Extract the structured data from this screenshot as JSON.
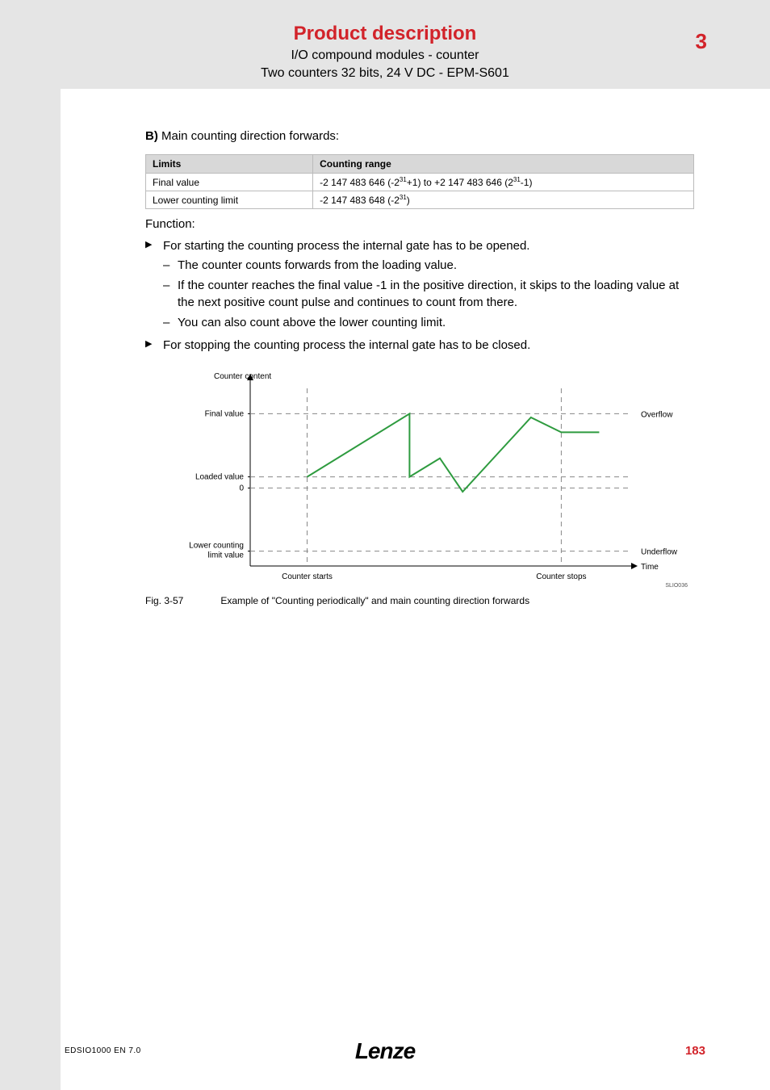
{
  "header": {
    "title": "Product description",
    "sub1": "I/O compound modules - counter",
    "sub2": "Two counters 32 bits, 24 V DC - EPM-S601",
    "chapter": "3"
  },
  "section": {
    "b_label": "B)",
    "b_text": " Main counting direction forwards:"
  },
  "table": {
    "headers": [
      "Limits",
      "Counting range"
    ],
    "rows": [
      {
        "limit": "Final value",
        "range_pre": "-2 147 483 646 (-2",
        "range_exp1": "31",
        "range_mid": "+1) to +2 147 483 646 (2",
        "range_exp2": "31",
        "range_post": "-1)"
      },
      {
        "limit": "Lower counting limit",
        "range_pre": "-2 147 483 648 (-2",
        "range_exp1": "31",
        "range_mid": ")",
        "range_exp2": "",
        "range_post": ""
      }
    ]
  },
  "function_label": "Function:",
  "bullets": {
    "b1": "For starting the counting process the internal gate has to be opened.",
    "b1_d1": "The counter counts forwards from the loading value.",
    "b1_d2": "If the counter reaches the final value -1 in the positive direction, it skips to the loading value at the next positive count pulse and continues to count from there.",
    "b1_d3": "You can also count above the lower counting limit.",
    "b2": "For stopping the counting process the internal gate has to be closed."
  },
  "chart_data": {
    "type": "line",
    "title": "",
    "xlabel": "Time",
    "ylabel": "Counter content",
    "y_levels": [
      {
        "name": "Final value",
        "y": 0.82
      },
      {
        "name": "Loaded value",
        "y": 0.48
      },
      {
        "name": "0",
        "y": 0.42
      },
      {
        "name": "Lower counting limit value",
        "y": 0.08
      }
    ],
    "x_events": [
      {
        "name": "Counter starts",
        "x": 0.15
      },
      {
        "name": "Counter stops",
        "x": 0.82
      }
    ],
    "series": [
      {
        "name": "counter",
        "color": "#2e9b3f",
        "points": [
          [
            0.15,
            0.48
          ],
          [
            0.42,
            0.82
          ],
          [
            0.42,
            0.48
          ],
          [
            0.5,
            0.58
          ],
          [
            0.56,
            0.4
          ],
          [
            0.74,
            0.8
          ],
          [
            0.82,
            0.72
          ],
          [
            0.92,
            0.72
          ]
        ]
      }
    ],
    "right_labels": [
      {
        "name": "Overflow",
        "y": 0.82
      },
      {
        "name": "Underflow",
        "y": 0.08
      },
      {
        "name": "Time",
        "y": 0.0
      }
    ],
    "code": "SLIO036"
  },
  "figure": {
    "num": "Fig. 3-57",
    "caption": "Example of \"Counting periodically\" and main counting direction forwards"
  },
  "footer": {
    "left": "EDSIO1000 EN 7.0",
    "center": "Lenze",
    "right": "183"
  }
}
